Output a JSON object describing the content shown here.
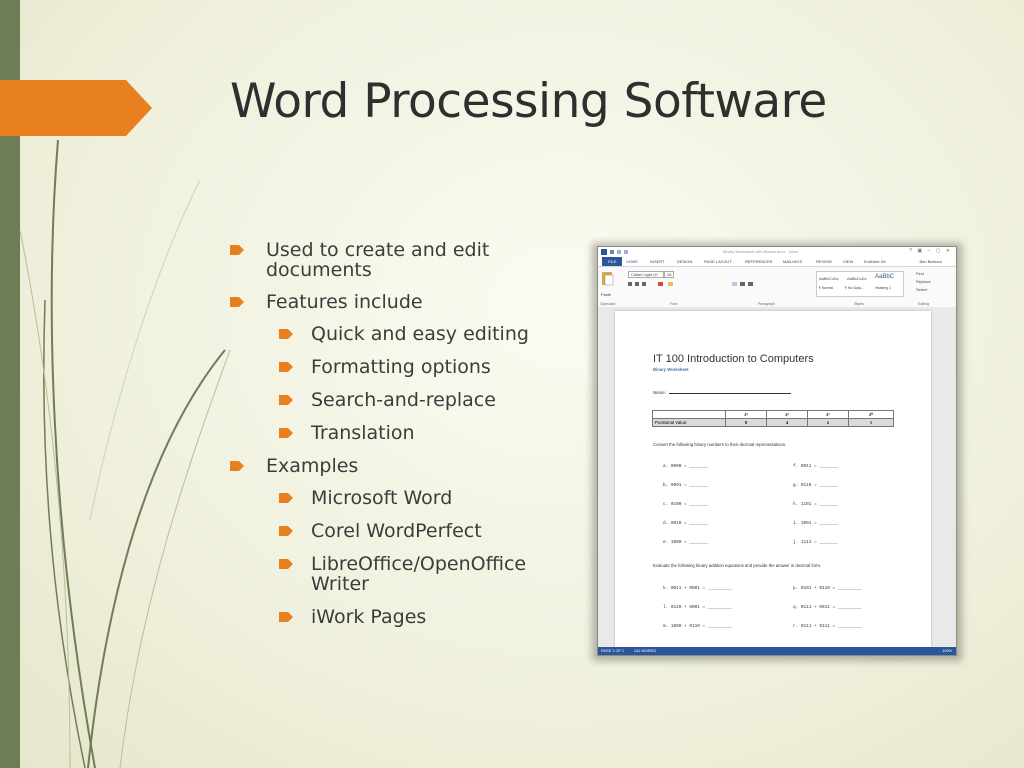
{
  "slide": {
    "title": "Word Processing Software",
    "accent_color": "#e8801f",
    "sidebar_color": "#6f7d56",
    "bullets": [
      {
        "level": 1,
        "text": "Used to create and edit documents"
      },
      {
        "level": 1,
        "text": "Features include"
      },
      {
        "level": 2,
        "text": "Quick and easy editing"
      },
      {
        "level": 2,
        "text": "Formatting options"
      },
      {
        "level": 2,
        "text": "Search-and-replace"
      },
      {
        "level": 2,
        "text": "Translation"
      },
      {
        "level": 1,
        "text": "Examples"
      },
      {
        "level": 2,
        "text": "Microsoft Word"
      },
      {
        "level": 2,
        "text": "Corel WordPerfect"
      },
      {
        "level": 2,
        "text": "LibreOffice/OpenOffice Writer"
      },
      {
        "level": 2,
        "text": "iWork Pages"
      }
    ]
  },
  "word": {
    "window_title": "Binary Worksheet with Blanks.docx - Word",
    "window_controls": "? ▣ – ▢ ✕",
    "tabs": [
      "FILE",
      "HOME",
      "INSERT",
      "DESIGN",
      "PAGE LAYOUT",
      "REFERENCES",
      "MAILINGS",
      "REVIEW",
      "VIEW",
      "EndNote X6"
    ],
    "user": "Ben Barbour",
    "ribbon": {
      "paste": "Paste",
      "font_name": "Calibri Light (H",
      "font_size": "28",
      "styles": [
        "AaBbCcDc",
        "AaBbCcDc",
        "AaBbC"
      ],
      "style_names": [
        "¶ Normal",
        "¶ No Spac...",
        "Heading 1"
      ],
      "editing": [
        "Find",
        "Replace",
        "Select"
      ],
      "groups": [
        "Clipboard",
        "Font",
        "Paragraph",
        "Styles",
        "Editing"
      ]
    },
    "document": {
      "title": "IT 100 Introduction to Computers",
      "subtitle": "Binary Worksheet",
      "name_label": "Name:",
      "table": {
        "headers": [
          "2³",
          "2²",
          "2¹",
          "2⁰"
        ],
        "row_label": "Positional Value:",
        "values": [
          "8",
          "4",
          "2",
          "1"
        ]
      },
      "instruction1": "Convert the following binary numbers to their decimal representations.",
      "problems1": [
        [
          "a. 0000 = _______",
          "f. 0011 = _______"
        ],
        [
          "b. 0001 = _______",
          "g. 0110 = _______"
        ],
        [
          "c. 0100 = _______",
          "h. 1101 = _______"
        ],
        [
          "d. 0010 = _______",
          "i. 1001 = _______"
        ],
        [
          "e. 1000 = _______",
          "j. 1111 = _______"
        ]
      ],
      "instruction2": "Evaluate the following binary addition equations and provide the answer in decimal form.",
      "problems2": [
        [
          "k. 0011 + 0001 = _________",
          "p. 0101 + 0110 = _________"
        ],
        [
          "l. 0110 + 0001 = _________",
          "q. 0111 + 0011 = _________"
        ],
        [
          "m. 1000 + 0110 = _________",
          "r. 0111 + 0111 = _________"
        ]
      ]
    },
    "status": {
      "page": "PAGE 1 OF 1",
      "words": "141 WORDS",
      "zoom": "100%"
    }
  }
}
